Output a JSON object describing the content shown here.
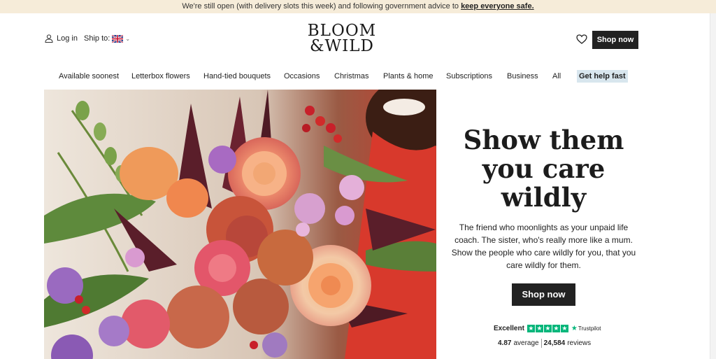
{
  "banner": {
    "text": "We're still open (with delivery slots this week) and following government advice to",
    "link": "keep everyone safe."
  },
  "header": {
    "login_label": "Log in",
    "ship_label": "Ship to:",
    "logo_line1": "BLOOM",
    "logo_line2": "&WILD",
    "shop_now": "Shop now"
  },
  "nav": {
    "items": [
      "Available soonest",
      "Letterbox flowers",
      "Hand-tied bouquets",
      "Occasions",
      "Christmas",
      "Plants & home",
      "Subscriptions",
      "Business",
      "All"
    ],
    "help": "Get help fast"
  },
  "hero": {
    "headline_line1": "Show them",
    "headline_line2": "you care",
    "headline_line3": "wildly",
    "subtext": "The friend who moonlights as your unpaid life coach. The sister, who's really more like a mum. Show the people who care wildly for you, that you care wildly for them.",
    "cta": "Shop now"
  },
  "trustpilot": {
    "label": "Excellent",
    "brand": "Trustpilot",
    "average": "4.87",
    "average_label": "average",
    "reviews": "24,584",
    "reviews_label": "reviews"
  },
  "colors": {
    "banner_bg": "#f6ecd9",
    "button": "#222222",
    "trustpilot_green": "#00b67a",
    "help_bg": "#d8e6ee"
  }
}
